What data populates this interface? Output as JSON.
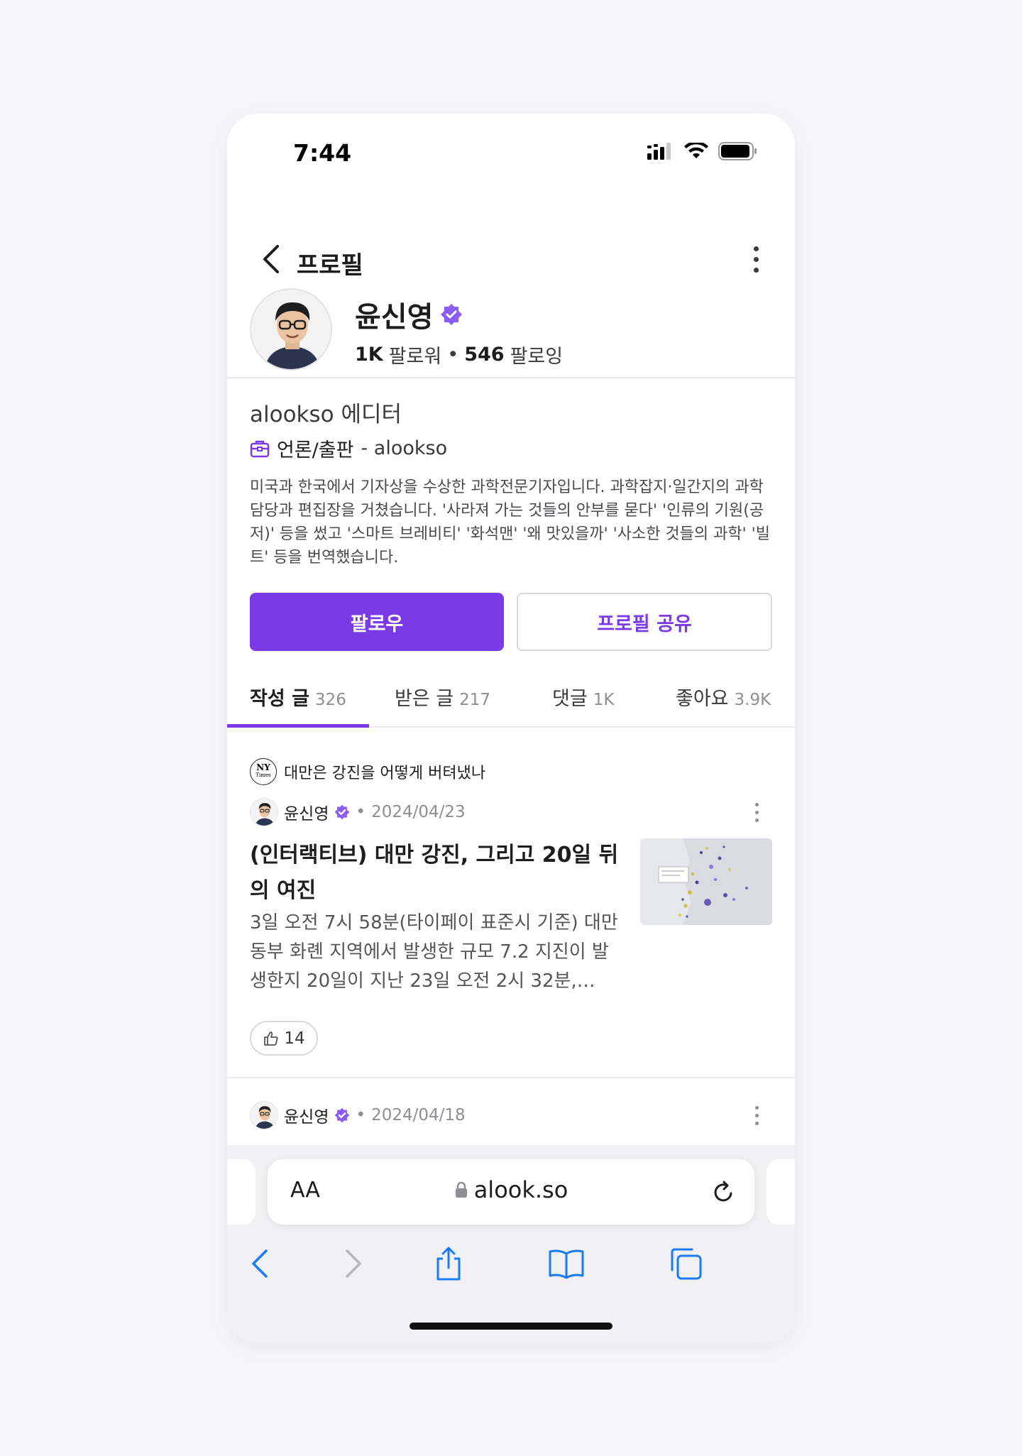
{
  "status": {
    "time": "7:44"
  },
  "nav": {
    "title": "프로필"
  },
  "profile": {
    "name": "윤신영",
    "followers_value": "1K",
    "followers_label": "팔로워",
    "separator": "•",
    "following_value": "546",
    "following_label": "팔로잉",
    "role": "alookso 에디터",
    "org_category": "언론/출판",
    "org_suffix": "- alookso",
    "bio": "미국과 한국에서 기자상을 수상한 과학전문기자입니다. 과학잡지·일간지의 과학담당과 편집장을 거쳤습니다. '사라져 가는 것들의 안부를 묻다' '인류의 기원(공저)' 등을 썼고 '스마트 브레비티' '화석맨' '왜 맛있을까' '사소한 것들의 과학' '빌트' 등을 번역했습니다."
  },
  "actions": {
    "follow": "팔로우",
    "share": "프로필 공유"
  },
  "tabs": [
    {
      "label": "작성 글",
      "count": "326"
    },
    {
      "label": "받은 글",
      "count": "217"
    },
    {
      "label": "댓글",
      "count": "1K"
    },
    {
      "label": "좋아요",
      "count": "3.9K"
    }
  ],
  "post1": {
    "source_title": "대만은 강진을 어떻게 버텨냈나",
    "source_logo": "NY",
    "source_logo_sub": "Times",
    "author": "윤신영",
    "date_sep": "•",
    "date": "2024/04/23",
    "title": "(인터랙티브) 대만 강진, 그리고 20일 뒤의 여진",
    "body": "3일 오전 7시 58분(타이페이 표준시 기준) 대만 동부 화롄 지역에서 발생한 규모 7.2 지진이 발생한지 20일이 지난 23일 오전 2시 32분,…",
    "likes": "14"
  },
  "post2": {
    "author": "윤신영",
    "date_sep": "•",
    "date": "2024/04/18"
  },
  "browser": {
    "text_size": "AA",
    "url": "alook.so"
  },
  "colors": {
    "accent": "#7b3ae8",
    "ios_blue": "#1a7cf5"
  }
}
